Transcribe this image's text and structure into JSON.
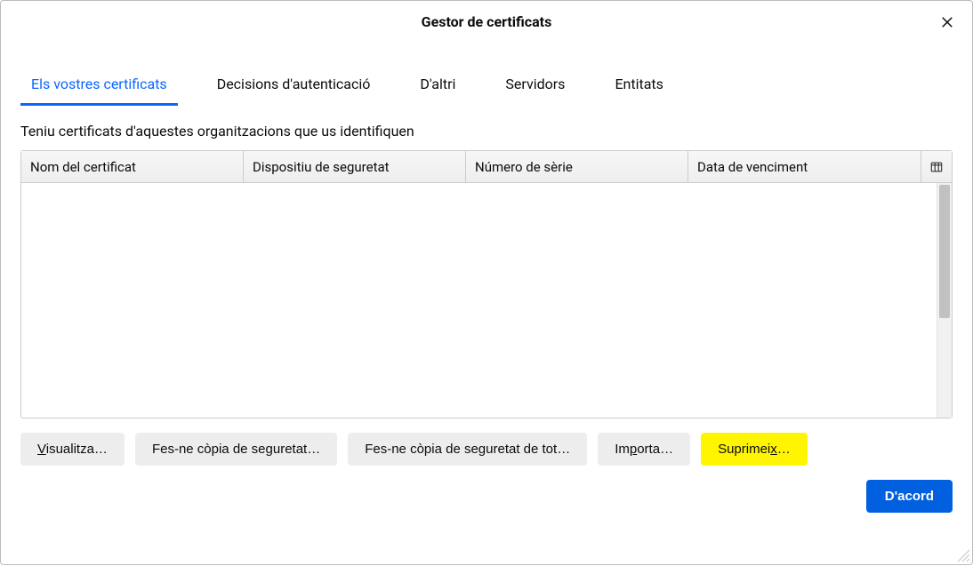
{
  "dialog": {
    "title": "Gestor de certificats"
  },
  "tabs": {
    "items": [
      {
        "label": "Els vostres certificats",
        "active": true
      },
      {
        "label": "Decisions d'autenticació",
        "active": false
      },
      {
        "label": "D'altri",
        "active": false
      },
      {
        "label": "Servidors",
        "active": false
      },
      {
        "label": "Entitats",
        "active": false
      }
    ]
  },
  "description": "Teniu certificats d'aquestes organitzacions que us identifiquen",
  "table": {
    "columns": [
      "Nom del certificat",
      "Dispositiu de seguretat",
      "Número de sèrie",
      "Data de venciment"
    ],
    "rows": []
  },
  "actions": {
    "view_prefix": "V",
    "view_rest": "isualitza…",
    "backup": "Fes-ne còpia de seguretat…",
    "backup_all": "Fes-ne còpia de seguretat de tot…",
    "import_prefix": "Im",
    "import_ul": "p",
    "import_rest": "orta…",
    "delete_prefix": "Suprimei",
    "delete_ul": "x",
    "delete_rest": "…"
  },
  "footer": {
    "ok": "D'acord"
  }
}
